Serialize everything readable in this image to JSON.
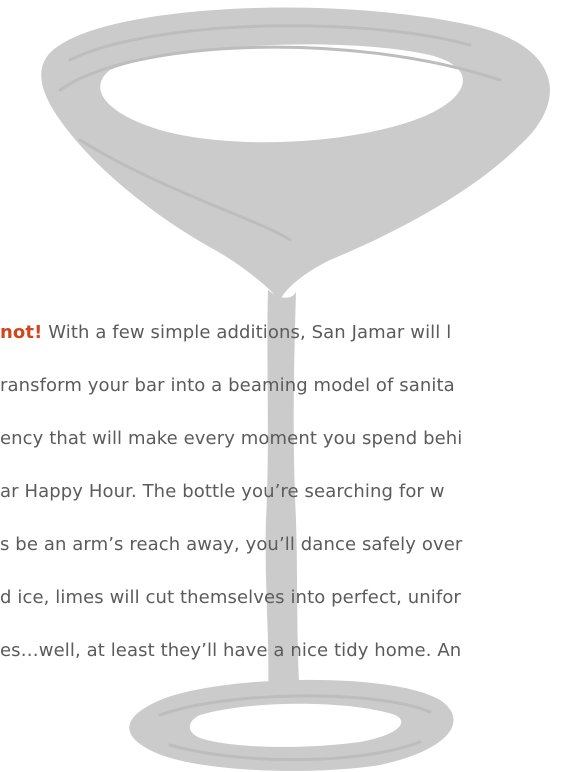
{
  "body": {
    "lines": [
      {
        "emphasis": "not!",
        "text": " With a few simple additions, San Jamar will l"
      },
      {
        "emphasis": "",
        "text": "ransform your bar into a beaming model of sanita"
      },
      {
        "emphasis": "",
        "text": "ency that will make every moment you spend behi"
      },
      {
        "emphasis": "",
        "text": "ar Happy Hour. The bottle you’re searching for w"
      },
      {
        "emphasis": "",
        "text": "s be an arm’s reach away, you’ll dance safely over"
      },
      {
        "emphasis": "",
        "text": "d ice, limes will cut themselves into perfect, unifor"
      },
      {
        "emphasis": "",
        "text": "es…well, at least they’ll have a nice tidy home. An"
      }
    ]
  },
  "colors": {
    "text": "#5b5b5b",
    "emphasis": "#d2461e",
    "glass": "#c9c9c9"
  },
  "icons": {
    "background_graphic": "martini-glass-illustration"
  }
}
